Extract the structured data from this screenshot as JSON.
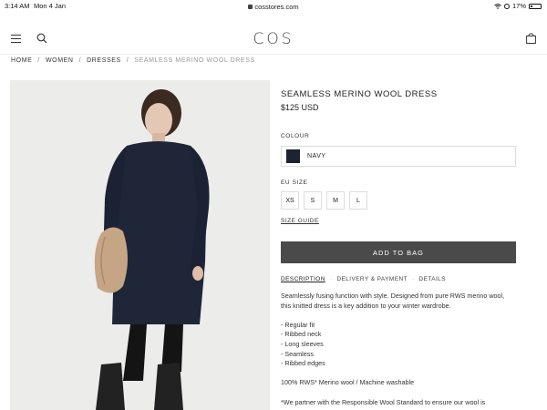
{
  "status_bar": {
    "time": "3:14 AM",
    "date": "Mon 4 Jan",
    "url": "cosstores.com",
    "battery": "17%"
  },
  "header": {
    "logo": "COS"
  },
  "breadcrumb": {
    "items": [
      "HOME",
      "WOMEN",
      "DRESSES"
    ],
    "current": "SEAMLESS MERINO WOOL DRESS",
    "separator": "/"
  },
  "product": {
    "title": "SEAMLESS MERINO WOOL DRESS",
    "price": "$125 USD",
    "colour_label": "COLOUR",
    "colour_name": "NAVY",
    "colour_hex": "#1c2433",
    "size_label": "EU SIZE",
    "sizes": [
      "XS",
      "S",
      "M",
      "L"
    ],
    "size_guide": "SIZE GUIDE",
    "add_to_bag": "ADD TO BAG"
  },
  "tabs": [
    "DESCRIPTION",
    "DELIVERY & PAYMENT",
    "DETAILS"
  ],
  "description": {
    "intro": "Seamlessly fusing function with style. Designed from pure RWS merino wool, this knitted dress is a key addition to your winter wardrobe.",
    "features": [
      "- Regular fit",
      "- Ribbed neck",
      "- Long sleeves",
      "- Seamless",
      "- Ribbed edges"
    ],
    "composition": "100% RWS* Merino wool / Machine washable",
    "footnote": "*We partner with the Responsible Wool Standard to ensure our wool is"
  }
}
